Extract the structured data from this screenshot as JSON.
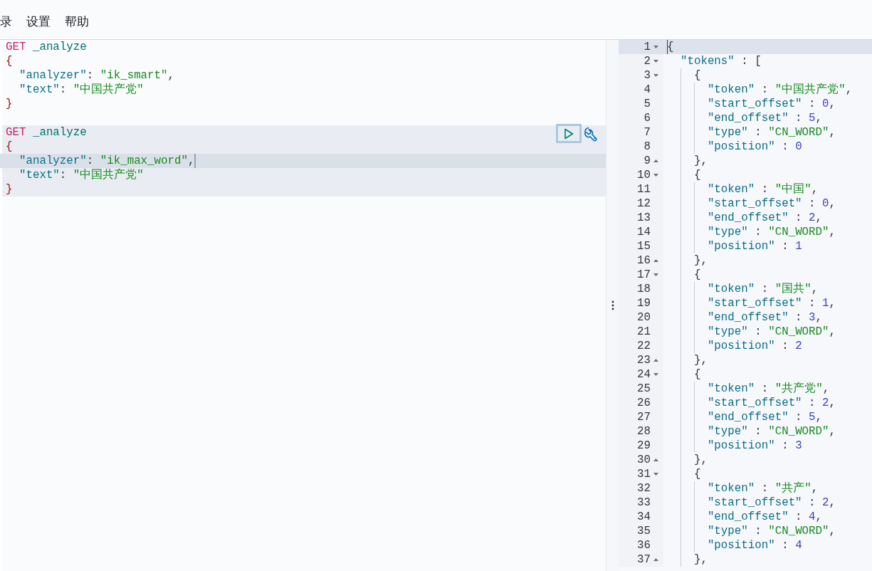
{
  "menu": [
    "录",
    "设置",
    "帮助"
  ],
  "editor": {
    "requests": [
      {
        "selected": false,
        "lines": [
          {
            "active": false,
            "segments": [
              {
                "kind": "method",
                "text": "GET"
              },
              {
                "kind": "path",
                "text": " _analyze"
              }
            ]
          },
          {
            "active": false,
            "segments": [
              {
                "kind": "brace",
                "text": "{"
              }
            ]
          },
          {
            "active": false,
            "segments": [
              {
                "kind": "key",
                "text": "  \"analyzer\""
              },
              {
                "kind": "punct",
                "text": ": "
              },
              {
                "kind": "string",
                "text": "\"ik_smart\""
              },
              {
                "kind": "punct",
                "text": ","
              }
            ]
          },
          {
            "active": false,
            "segments": [
              {
                "kind": "key",
                "text": "  \"text\""
              },
              {
                "kind": "punct",
                "text": ": "
              },
              {
                "kind": "string",
                "text": "\"中国共产党\""
              }
            ]
          },
          {
            "active": false,
            "segments": [
              {
                "kind": "brace",
                "text": "}"
              }
            ]
          }
        ]
      },
      {
        "selected": true,
        "lines": [
          {
            "active": false,
            "segments": [
              {
                "kind": "method",
                "text": "GET"
              },
              {
                "kind": "path",
                "text": " _analyze"
              }
            ]
          },
          {
            "active": false,
            "segments": [
              {
                "kind": "brace",
                "text": "{"
              }
            ]
          },
          {
            "active": true,
            "segments": [
              {
                "kind": "key",
                "text": "  \"analyzer\""
              },
              {
                "kind": "punct",
                "text": ": "
              },
              {
                "kind": "string",
                "text": "\"ik_max_word\""
              },
              {
                "kind": "punct",
                "text": ","
              }
            ]
          },
          {
            "active": false,
            "segments": [
              {
                "kind": "key",
                "text": "  \"text\""
              },
              {
                "kind": "punct",
                "text": ": "
              },
              {
                "kind": "string",
                "text": "\"中国共产党\""
              }
            ]
          },
          {
            "active": false,
            "segments": [
              {
                "kind": "brace",
                "text": "}"
              }
            ]
          }
        ]
      }
    ]
  },
  "output": {
    "lines": [
      {
        "number": "1",
        "kind": "fold_start",
        "active": true,
        "segments": [
          {
            "kind": "punct",
            "text": "{"
          }
        ]
      },
      {
        "number": "2",
        "kind": "fold_start",
        "active": false,
        "segments": [
          {
            "kind": "key",
            "text": "  \"tokens\""
          },
          {
            "kind": "punct",
            "text": " : ["
          }
        ]
      },
      {
        "number": "3",
        "kind": "fold_start",
        "active": false,
        "segments": [
          {
            "kind": "punct",
            "text": "    {"
          }
        ]
      },
      {
        "number": "4",
        "kind": "plain",
        "active": false,
        "segments": [
          {
            "kind": "key",
            "text": "      \"token\""
          },
          {
            "kind": "punct",
            "text": " : "
          },
          {
            "kind": "string",
            "text": "\"中国共产党\""
          },
          {
            "kind": "punct",
            "text": ","
          }
        ]
      },
      {
        "number": "5",
        "kind": "plain",
        "active": false,
        "segments": [
          {
            "kind": "key",
            "text": "      \"start_offset\""
          },
          {
            "kind": "punct",
            "text": " : "
          },
          {
            "kind": "number",
            "text": "0"
          },
          {
            "kind": "punct",
            "text": ","
          }
        ]
      },
      {
        "number": "6",
        "kind": "plain",
        "active": false,
        "segments": [
          {
            "kind": "key",
            "text": "      \"end_offset\""
          },
          {
            "kind": "punct",
            "text": " : "
          },
          {
            "kind": "number",
            "text": "5"
          },
          {
            "kind": "punct",
            "text": ","
          }
        ]
      },
      {
        "number": "7",
        "kind": "plain",
        "active": false,
        "segments": [
          {
            "kind": "key",
            "text": "      \"type\""
          },
          {
            "kind": "punct",
            "text": " : "
          },
          {
            "kind": "string",
            "text": "\"CN_WORD\""
          },
          {
            "kind": "punct",
            "text": ","
          }
        ]
      },
      {
        "number": "8",
        "kind": "plain",
        "active": false,
        "segments": [
          {
            "kind": "key",
            "text": "      \"position\""
          },
          {
            "kind": "punct",
            "text": " : "
          },
          {
            "kind": "number",
            "text": "0"
          }
        ]
      },
      {
        "number": "9",
        "kind": "fold_end",
        "active": false,
        "segments": [
          {
            "kind": "punct",
            "text": "    },"
          }
        ]
      },
      {
        "number": "10",
        "kind": "fold_start",
        "active": false,
        "segments": [
          {
            "kind": "punct",
            "text": "    {"
          }
        ]
      },
      {
        "number": "11",
        "kind": "plain",
        "active": false,
        "segments": [
          {
            "kind": "key",
            "text": "      \"token\""
          },
          {
            "kind": "punct",
            "text": " : "
          },
          {
            "kind": "string",
            "text": "\"中国\""
          },
          {
            "kind": "punct",
            "text": ","
          }
        ]
      },
      {
        "number": "12",
        "kind": "plain",
        "active": false,
        "segments": [
          {
            "kind": "key",
            "text": "      \"start_offset\""
          },
          {
            "kind": "punct",
            "text": " : "
          },
          {
            "kind": "number",
            "text": "0"
          },
          {
            "kind": "punct",
            "text": ","
          }
        ]
      },
      {
        "number": "13",
        "kind": "plain",
        "active": false,
        "segments": [
          {
            "kind": "key",
            "text": "      \"end_offset\""
          },
          {
            "kind": "punct",
            "text": " : "
          },
          {
            "kind": "number",
            "text": "2"
          },
          {
            "kind": "punct",
            "text": ","
          }
        ]
      },
      {
        "number": "14",
        "kind": "plain",
        "active": false,
        "segments": [
          {
            "kind": "key",
            "text": "      \"type\""
          },
          {
            "kind": "punct",
            "text": " : "
          },
          {
            "kind": "string",
            "text": "\"CN_WORD\""
          },
          {
            "kind": "punct",
            "text": ","
          }
        ]
      },
      {
        "number": "15",
        "kind": "plain",
        "active": false,
        "segments": [
          {
            "kind": "key",
            "text": "      \"position\""
          },
          {
            "kind": "punct",
            "text": " : "
          },
          {
            "kind": "number",
            "text": "1"
          }
        ]
      },
      {
        "number": "16",
        "kind": "fold_end",
        "active": false,
        "segments": [
          {
            "kind": "punct",
            "text": "    },"
          }
        ]
      },
      {
        "number": "17",
        "kind": "fold_start",
        "active": false,
        "segments": [
          {
            "kind": "punct",
            "text": "    {"
          }
        ]
      },
      {
        "number": "18",
        "kind": "plain",
        "active": false,
        "segments": [
          {
            "kind": "key",
            "text": "      \"token\""
          },
          {
            "kind": "punct",
            "text": " : "
          },
          {
            "kind": "string",
            "text": "\"国共\""
          },
          {
            "kind": "punct",
            "text": ","
          }
        ]
      },
      {
        "number": "19",
        "kind": "plain",
        "active": false,
        "segments": [
          {
            "kind": "key",
            "text": "      \"start_offset\""
          },
          {
            "kind": "punct",
            "text": " : "
          },
          {
            "kind": "number",
            "text": "1"
          },
          {
            "kind": "punct",
            "text": ","
          }
        ]
      },
      {
        "number": "20",
        "kind": "plain",
        "active": false,
        "segments": [
          {
            "kind": "key",
            "text": "      \"end_offset\""
          },
          {
            "kind": "punct",
            "text": " : "
          },
          {
            "kind": "number",
            "text": "3"
          },
          {
            "kind": "punct",
            "text": ","
          }
        ]
      },
      {
        "number": "21",
        "kind": "plain",
        "active": false,
        "segments": [
          {
            "kind": "key",
            "text": "      \"type\""
          },
          {
            "kind": "punct",
            "text": " : "
          },
          {
            "kind": "string",
            "text": "\"CN_WORD\""
          },
          {
            "kind": "punct",
            "text": ","
          }
        ]
      },
      {
        "number": "22",
        "kind": "plain",
        "active": false,
        "segments": [
          {
            "kind": "key",
            "text": "      \"position\""
          },
          {
            "kind": "punct",
            "text": " : "
          },
          {
            "kind": "number",
            "text": "2"
          }
        ]
      },
      {
        "number": "23",
        "kind": "fold_end",
        "active": false,
        "segments": [
          {
            "kind": "punct",
            "text": "    },"
          }
        ]
      },
      {
        "number": "24",
        "kind": "fold_start",
        "active": false,
        "segments": [
          {
            "kind": "punct",
            "text": "    {"
          }
        ]
      },
      {
        "number": "25",
        "kind": "plain",
        "active": false,
        "segments": [
          {
            "kind": "key",
            "text": "      \"token\""
          },
          {
            "kind": "punct",
            "text": " : "
          },
          {
            "kind": "string",
            "text": "\"共产党\""
          },
          {
            "kind": "punct",
            "text": ","
          }
        ]
      },
      {
        "number": "26",
        "kind": "plain",
        "active": false,
        "segments": [
          {
            "kind": "key",
            "text": "      \"start_offset\""
          },
          {
            "kind": "punct",
            "text": " : "
          },
          {
            "kind": "number",
            "text": "2"
          },
          {
            "kind": "punct",
            "text": ","
          }
        ]
      },
      {
        "number": "27",
        "kind": "plain",
        "active": false,
        "segments": [
          {
            "kind": "key",
            "text": "      \"end_offset\""
          },
          {
            "kind": "punct",
            "text": " : "
          },
          {
            "kind": "number",
            "text": "5"
          },
          {
            "kind": "punct",
            "text": ","
          }
        ]
      },
      {
        "number": "28",
        "kind": "plain",
        "active": false,
        "segments": [
          {
            "kind": "key",
            "text": "      \"type\""
          },
          {
            "kind": "punct",
            "text": " : "
          },
          {
            "kind": "string",
            "text": "\"CN_WORD\""
          },
          {
            "kind": "punct",
            "text": ","
          }
        ]
      },
      {
        "number": "29",
        "kind": "plain",
        "active": false,
        "segments": [
          {
            "kind": "key",
            "text": "      \"position\""
          },
          {
            "kind": "punct",
            "text": " : "
          },
          {
            "kind": "number",
            "text": "3"
          }
        ]
      },
      {
        "number": "30",
        "kind": "fold_end",
        "active": false,
        "segments": [
          {
            "kind": "punct",
            "text": "    },"
          }
        ]
      },
      {
        "number": "31",
        "kind": "fold_start",
        "active": false,
        "segments": [
          {
            "kind": "punct",
            "text": "    {"
          }
        ]
      },
      {
        "number": "32",
        "kind": "plain",
        "active": false,
        "segments": [
          {
            "kind": "key",
            "text": "      \"token\""
          },
          {
            "kind": "punct",
            "text": " : "
          },
          {
            "kind": "string",
            "text": "\"共产\""
          },
          {
            "kind": "punct",
            "text": ","
          }
        ]
      },
      {
        "number": "33",
        "kind": "plain",
        "active": false,
        "segments": [
          {
            "kind": "key",
            "text": "      \"start_offset\""
          },
          {
            "kind": "punct",
            "text": " : "
          },
          {
            "kind": "number",
            "text": "2"
          },
          {
            "kind": "punct",
            "text": ","
          }
        ]
      },
      {
        "number": "34",
        "kind": "plain",
        "active": false,
        "segments": [
          {
            "kind": "key",
            "text": "      \"end_offset\""
          },
          {
            "kind": "punct",
            "text": " : "
          },
          {
            "kind": "number",
            "text": "4"
          },
          {
            "kind": "punct",
            "text": ","
          }
        ]
      },
      {
        "number": "35",
        "kind": "plain",
        "active": false,
        "segments": [
          {
            "kind": "key",
            "text": "      \"type\""
          },
          {
            "kind": "punct",
            "text": " : "
          },
          {
            "kind": "string",
            "text": "\"CN_WORD\""
          },
          {
            "kind": "punct",
            "text": ","
          }
        ]
      },
      {
        "number": "36",
        "kind": "plain",
        "active": false,
        "segments": [
          {
            "kind": "key",
            "text": "      \"position\""
          },
          {
            "kind": "punct",
            "text": " : "
          },
          {
            "kind": "number",
            "text": "4"
          }
        ]
      },
      {
        "number": "37",
        "kind": "fold_end",
        "active": false,
        "segments": [
          {
            "kind": "punct",
            "text": "    },"
          }
        ]
      }
    ]
  }
}
